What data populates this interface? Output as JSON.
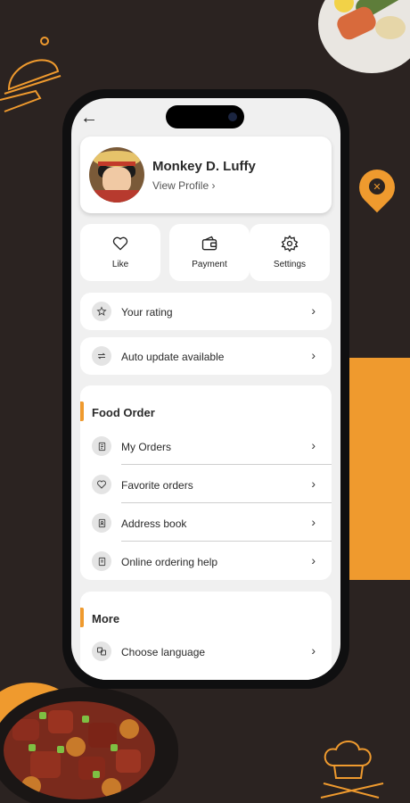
{
  "colors": {
    "background": "#2b2321",
    "accent": "#ef9a2e",
    "card": "#ffffff",
    "screen": "#f0f0f0"
  },
  "header": {
    "back_icon": "arrow-left-icon",
    "back_label": "←"
  },
  "profile": {
    "name": "Monkey D. Luffy",
    "view_label": "View Profile ›"
  },
  "quick_actions": [
    {
      "label": "Like",
      "icon": "heart-icon"
    },
    {
      "label": "Payment",
      "icon": "wallet-icon"
    },
    {
      "label": "Settings",
      "icon": "gear-icon"
    }
  ],
  "rows": [
    {
      "label": "Your rating",
      "icon": "star-icon"
    },
    {
      "label": "Auto update available",
      "icon": "repeat-icon"
    }
  ],
  "food_order": {
    "title": "Food Order",
    "items": [
      {
        "label": "My Orders",
        "icon": "orders-icon"
      },
      {
        "label": "Favorite orders",
        "icon": "heart-icon"
      },
      {
        "label": "Address book",
        "icon": "address-book-icon"
      },
      {
        "label": "Online ordering help",
        "icon": "help-document-icon"
      }
    ]
  },
  "more": {
    "title": "More",
    "items": [
      {
        "label": "Choose language",
        "icon": "language-icon"
      }
    ]
  },
  "chevron": "›"
}
